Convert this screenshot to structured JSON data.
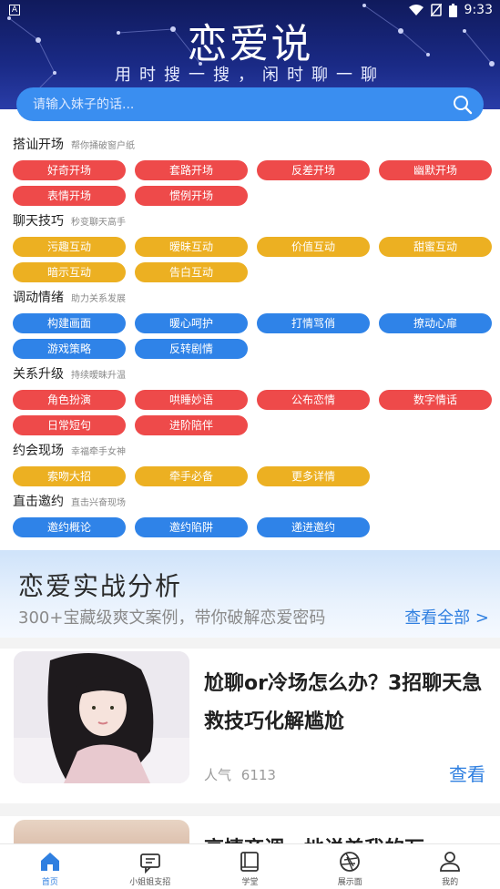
{
  "status": {
    "left_badge": "A",
    "time": "9:33"
  },
  "hero": {
    "title": "恋爱说",
    "slogan": "用时搜一搜，闲时聊一聊"
  },
  "search": {
    "placeholder": "请输入妹子的话..."
  },
  "categories": [
    {
      "title": "搭讪开场",
      "subtitle": "帮你捅破窗户纸",
      "color": "#ee4a4a",
      "tags": [
        "好奇开场",
        "套路开场",
        "反差开场",
        "幽默开场",
        "表情开场",
        "惯例开场"
      ]
    },
    {
      "title": "聊天技巧",
      "subtitle": "秒变聊天高手",
      "color": "#ecb022",
      "tags": [
        "污趣互动",
        "暧昧互动",
        "价值互动",
        "甜蜜互动",
        "暗示互动",
        "告白互动"
      ]
    },
    {
      "title": "调动情绪",
      "subtitle": "助力关系发展",
      "color": "#2f83e8",
      "tags": [
        "构建画面",
        "暖心呵护",
        "打情骂俏",
        "撩动心扉",
        "游戏策略",
        "反转剧情"
      ]
    },
    {
      "title": "关系升级",
      "subtitle": "持续暧昧升温",
      "color": "#ee4a4a",
      "tags": [
        "角色扮演",
        "哄睡妙语",
        "公布恋情",
        "数字情话",
        "日常短句",
        "进阶陪伴"
      ]
    },
    {
      "title": "约会现场",
      "subtitle": "幸福牵手女神",
      "color": "#ecb022",
      "tags": [
        "索吻大招",
        "牵手必备",
        "更多详情"
      ]
    },
    {
      "title": "直击邀约",
      "subtitle": "直击兴奋现场",
      "color": "#2f83e8",
      "tags": [
        "邀约概论",
        "邀约陷阱",
        "递进邀约"
      ]
    }
  ],
  "banner": {
    "title": "恋爱实战分析",
    "subtitle": "300+宝藏级爽文案例，带你破解恋爱密码",
    "link": "查看全部 >"
  },
  "articles": [
    {
      "title": "尬聊or冷场怎么办？3招聊天急救技巧化解尴尬",
      "pop_label": "人气",
      "pop_value": "6113",
      "action": "查看"
    },
    {
      "title": "高情商调…地说美我的万"
    }
  ],
  "nav": [
    {
      "label": "首页",
      "icon": "home-icon",
      "active": true
    },
    {
      "label": "小姐姐支招",
      "icon": "chat-bubble-icon",
      "active": false
    },
    {
      "label": "学堂",
      "icon": "book-icon",
      "active": false
    },
    {
      "label": "展示面",
      "icon": "aperture-icon",
      "active": false
    },
    {
      "label": "我的",
      "icon": "user-icon",
      "active": false
    }
  ],
  "colors": {
    "primary": "#2f7fe0",
    "red": "#ee4a4a",
    "gold": "#ecb022",
    "blue": "#2f83e8"
  }
}
